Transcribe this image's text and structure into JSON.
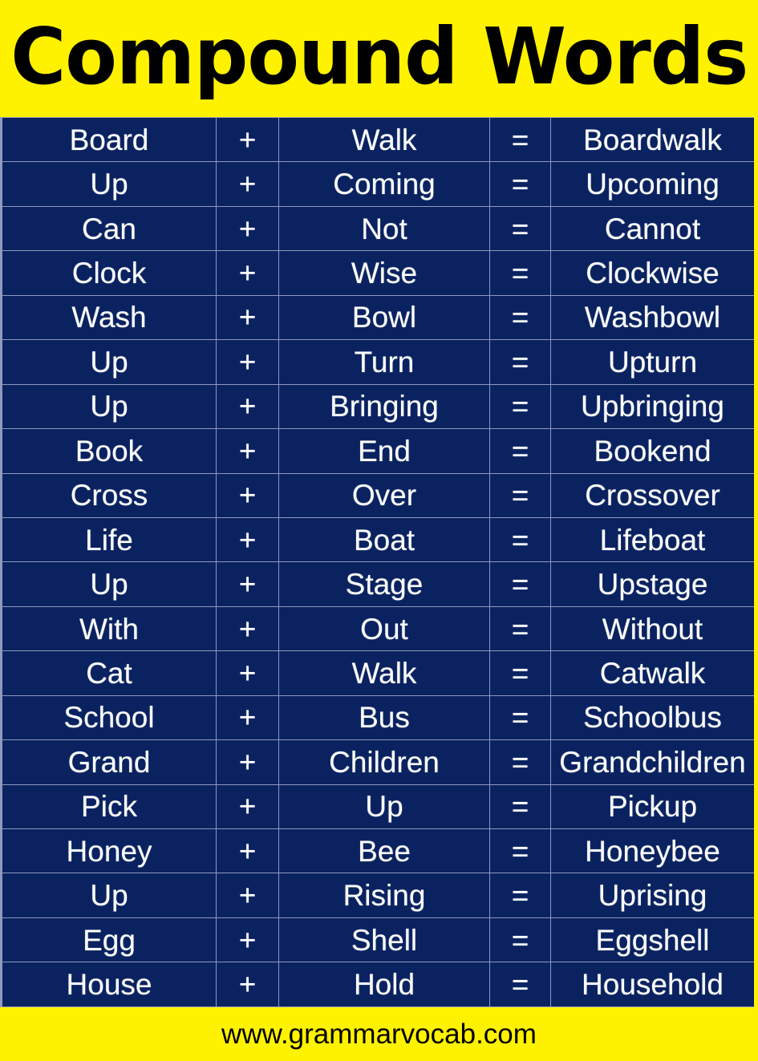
{
  "header": {
    "title": "Compound Words",
    "background_color": "#fff200",
    "text_color": "#000000"
  },
  "table": {
    "background_color": "#0a2260",
    "border_color": "#8f99bd",
    "text_color": "#ffffff",
    "plus_symbol": "+",
    "equals_symbol": "=",
    "rows": [
      {
        "first": "Board",
        "op1": "+",
        "second": "Walk",
        "op2": "=",
        "result": "Boardwalk"
      },
      {
        "first": "Up",
        "op1": "+",
        "second": "Coming",
        "op2": "=",
        "result": "Upcoming"
      },
      {
        "first": "Can",
        "op1": "+",
        "second": "Not",
        "op2": "=",
        "result": "Cannot"
      },
      {
        "first": "Clock",
        "op1": "+",
        "second": "Wise",
        "op2": "=",
        "result": "Clockwise"
      },
      {
        "first": "Wash",
        "op1": "+",
        "second": "Bowl",
        "op2": "=",
        "result": "Washbowl"
      },
      {
        "first": "Up",
        "op1": "+",
        "second": "Turn",
        "op2": "=",
        "result": "Upturn"
      },
      {
        "first": "Up",
        "op1": "+",
        "second": "Bringing",
        "op2": "=",
        "result": "Upbringing"
      },
      {
        "first": "Book",
        "op1": "+",
        "second": "End",
        "op2": "=",
        "result": "Bookend"
      },
      {
        "first": "Cross",
        "op1": "+",
        "second": "Over",
        "op2": "=",
        "result": "Crossover"
      },
      {
        "first": "Life",
        "op1": "+",
        "second": "Boat",
        "op2": "=",
        "result": "Lifeboat"
      },
      {
        "first": "Up",
        "op1": "+",
        "second": "Stage",
        "op2": "=",
        "result": "Upstage"
      },
      {
        "first": "With",
        "op1": "+",
        "second": "Out",
        "op2": "=",
        "result": "Without"
      },
      {
        "first": "Cat",
        "op1": "+",
        "second": "Walk",
        "op2": "=",
        "result": "Catwalk"
      },
      {
        "first": "School",
        "op1": "+",
        "second": "Bus",
        "op2": "=",
        "result": "Schoolbus"
      },
      {
        "first": "Grand",
        "op1": "+",
        "second": "Children",
        "op2": "=",
        "result": "Grandchildren"
      },
      {
        "first": "Pick",
        "op1": "+",
        "second": "Up",
        "op2": "=",
        "result": "Pickup"
      },
      {
        "first": "Honey",
        "op1": "+",
        "second": "Bee",
        "op2": "=",
        "result": "Honeybee"
      },
      {
        "first": "Up",
        "op1": "+",
        "second": "Rising",
        "op2": "=",
        "result": "Uprising"
      },
      {
        "first": "Egg",
        "op1": "+",
        "second": "Shell",
        "op2": "=",
        "result": "Eggshell"
      },
      {
        "first": "House",
        "op1": "+",
        "second": "Hold",
        "op2": "=",
        "result": "Household"
      }
    ]
  },
  "footer": {
    "website": "www.grammarvocab.com",
    "background_color": "#fff200",
    "text_color": "#000000"
  }
}
